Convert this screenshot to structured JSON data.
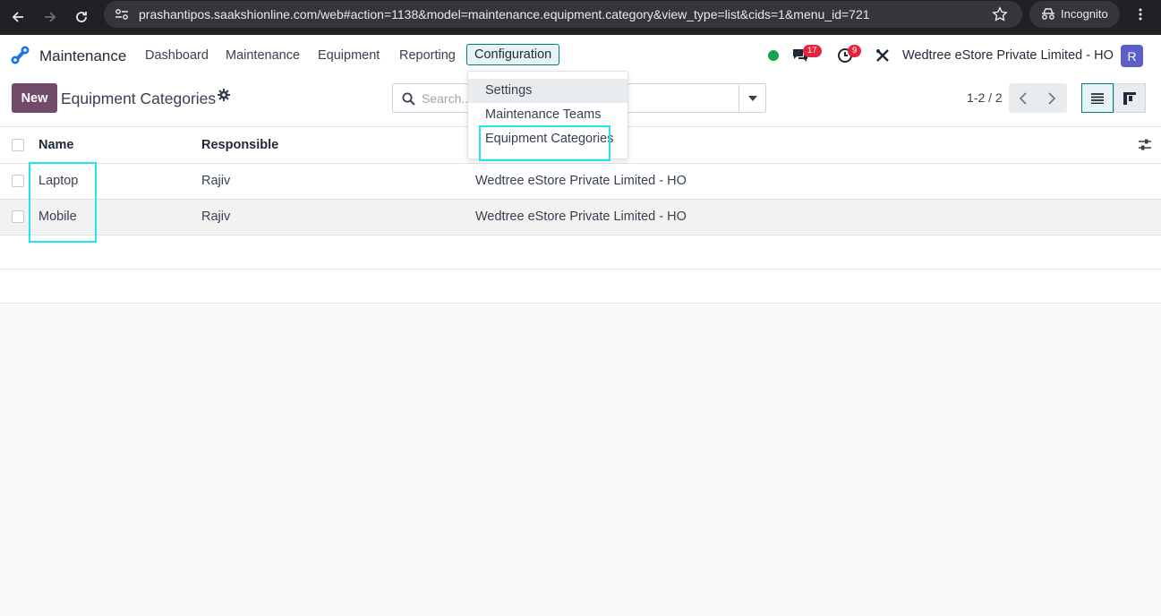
{
  "browser": {
    "url": "prashantipos.saakshionline.com/web#action=1138&model=maintenance.equipment.category&view_type=list&cids=1&menu_id=721",
    "incognito_label": "Incognito"
  },
  "navbar": {
    "app_name": "Maintenance",
    "menu": [
      "Dashboard",
      "Maintenance",
      "Equipment",
      "Reporting",
      "Configuration"
    ],
    "messages_count": "17",
    "activities_count": "9",
    "company": "Wedtree eStore Private Limited - HO",
    "avatar_letter": "R"
  },
  "control": {
    "new_label": "New",
    "title": "Equipment Categories",
    "search_placeholder": "Search...",
    "pager": "1-2 / 2"
  },
  "dropdown": {
    "items": [
      "Settings",
      "Maintenance Teams",
      "Equipment Categories"
    ]
  },
  "table": {
    "headers": [
      "Name",
      "Responsible"
    ],
    "rows": [
      {
        "name": "Laptop",
        "responsible": "Rajiv",
        "company": "Wedtree eStore Private Limited - HO"
      },
      {
        "name": "Mobile",
        "responsible": "Rajiv",
        "company": "Wedtree eStore Private Limited - HO"
      }
    ]
  },
  "colors": {
    "brand": "#714b67",
    "accent": "#017e84",
    "highlight": "#22e4f0",
    "badge": "#e3263e"
  }
}
